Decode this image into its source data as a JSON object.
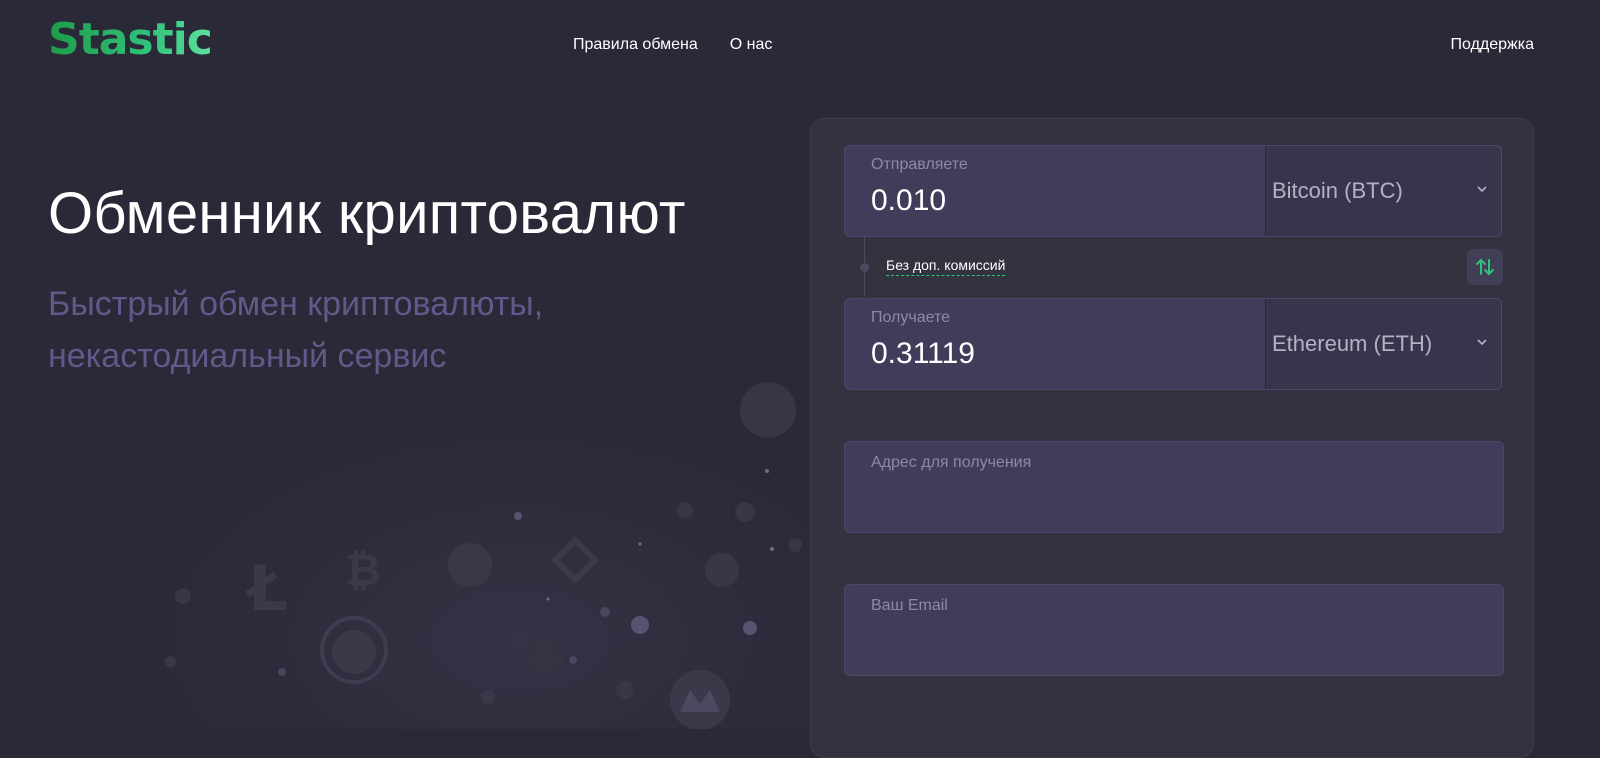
{
  "brand": {
    "logo_text": "Stastic",
    "accent": "#2fc27a"
  },
  "nav": {
    "items": [
      {
        "label": "Правила обмена"
      },
      {
        "label": "О нас"
      }
    ],
    "support_label": "Поддержка"
  },
  "hero": {
    "title": "Обменник криптовалют",
    "subtitle": "Быстрый обмен криптовалюты, некастодиальный сервис"
  },
  "exchange": {
    "send": {
      "label": "Отправляете",
      "value": "0.010",
      "currency": "Bitcoin (BTC)"
    },
    "no_fee_label": "Без доп. комиссий",
    "receive": {
      "label": "Получаете",
      "value": "0.31119",
      "currency": "Ethereum (ETH)"
    },
    "address": {
      "label": "Адрес для получения",
      "value": ""
    },
    "email": {
      "label": "Ваш Email",
      "value": ""
    }
  },
  "icons": {
    "chevron": "chevron-down-icon",
    "swap": "swap-arrows-icon"
  }
}
